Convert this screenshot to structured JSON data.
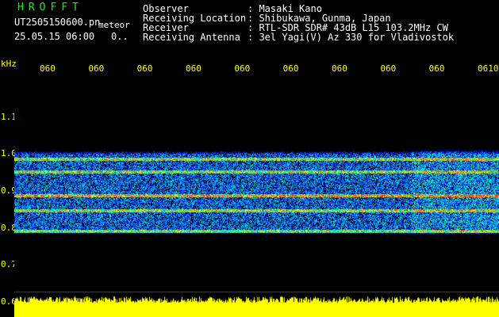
{
  "header": {
    "brand": "HROFFT",
    "file_name": "UT2505150600.pn",
    "file_suffix": "meteor",
    "date_time": "25.05.15 06:00",
    "date_extra": "0..",
    "fields": [
      {
        "label": "Observer",
        "value": ": Masaki Kano"
      },
      {
        "label": "Receiving Location",
        "value": ": Shibukawa, Gunma, Japan"
      },
      {
        "label": "Receiver",
        "value": ": RTL-SDR SDR# 43dB L15 103.2MHz CW"
      },
      {
        "label": "Receiving Antenna",
        "value": ": 3el Yagi(V) Az 330 for Vladivostok"
      }
    ]
  },
  "colors": {
    "brand": "#00ff00",
    "tick_text": "#ffff00",
    "header_text": "#ffffff",
    "background": "#000000",
    "level_fill": "#ffff00"
  },
  "chart_data": {
    "type": "heatmap",
    "y_unit_label": "kHz",
    "y_ticks": [
      "1.1",
      "1.0",
      "0.9",
      "0.8",
      "0.7",
      "0.6"
    ],
    "y_tick_values": [
      1.1,
      1.0,
      0.9,
      0.8,
      0.7,
      0.6
    ],
    "x_ticks": [
      "060",
      "060",
      "060",
      "060",
      "060",
      "060",
      "060",
      "060",
      "060",
      "0610"
    ],
    "ylim": [
      0.6,
      1.2
    ],
    "signal_band_khz": [
      0.78,
      1.01
    ],
    "strong_lines_khz": [
      0.985,
      0.95,
      0.885,
      0.845,
      0.79
    ]
  }
}
